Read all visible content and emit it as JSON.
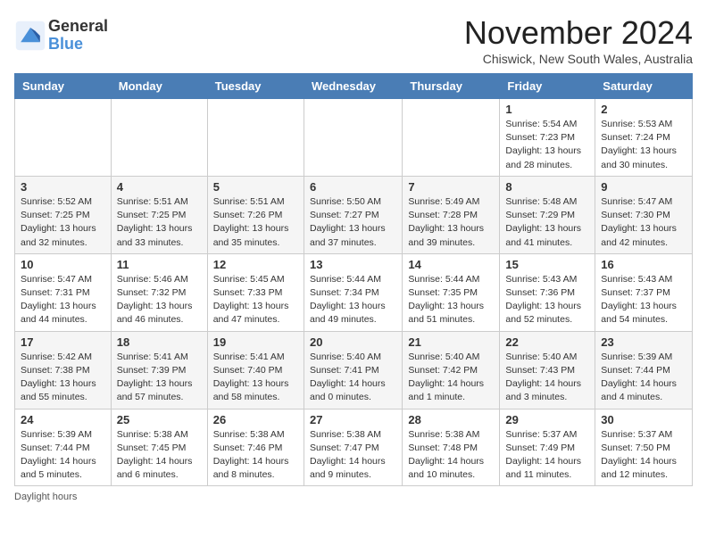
{
  "header": {
    "logo_general": "General",
    "logo_blue": "Blue",
    "month_title": "November 2024",
    "location": "Chiswick, New South Wales, Australia"
  },
  "days_of_week": [
    "Sunday",
    "Monday",
    "Tuesday",
    "Wednesday",
    "Thursday",
    "Friday",
    "Saturday"
  ],
  "footer": {
    "daylight_label": "Daylight hours"
  },
  "weeks": [
    [
      {
        "day": "",
        "info": ""
      },
      {
        "day": "",
        "info": ""
      },
      {
        "day": "",
        "info": ""
      },
      {
        "day": "",
        "info": ""
      },
      {
        "day": "",
        "info": ""
      },
      {
        "day": "1",
        "info": "Sunrise: 5:54 AM\nSunset: 7:23 PM\nDaylight: 13 hours\nand 28 minutes."
      },
      {
        "day": "2",
        "info": "Sunrise: 5:53 AM\nSunset: 7:24 PM\nDaylight: 13 hours\nand 30 minutes."
      }
    ],
    [
      {
        "day": "3",
        "info": "Sunrise: 5:52 AM\nSunset: 7:25 PM\nDaylight: 13 hours\nand 32 minutes."
      },
      {
        "day": "4",
        "info": "Sunrise: 5:51 AM\nSunset: 7:25 PM\nDaylight: 13 hours\nand 33 minutes."
      },
      {
        "day": "5",
        "info": "Sunrise: 5:51 AM\nSunset: 7:26 PM\nDaylight: 13 hours\nand 35 minutes."
      },
      {
        "day": "6",
        "info": "Sunrise: 5:50 AM\nSunset: 7:27 PM\nDaylight: 13 hours\nand 37 minutes."
      },
      {
        "day": "7",
        "info": "Sunrise: 5:49 AM\nSunset: 7:28 PM\nDaylight: 13 hours\nand 39 minutes."
      },
      {
        "day": "8",
        "info": "Sunrise: 5:48 AM\nSunset: 7:29 PM\nDaylight: 13 hours\nand 41 minutes."
      },
      {
        "day": "9",
        "info": "Sunrise: 5:47 AM\nSunset: 7:30 PM\nDaylight: 13 hours\nand 42 minutes."
      }
    ],
    [
      {
        "day": "10",
        "info": "Sunrise: 5:47 AM\nSunset: 7:31 PM\nDaylight: 13 hours\nand 44 minutes."
      },
      {
        "day": "11",
        "info": "Sunrise: 5:46 AM\nSunset: 7:32 PM\nDaylight: 13 hours\nand 46 minutes."
      },
      {
        "day": "12",
        "info": "Sunrise: 5:45 AM\nSunset: 7:33 PM\nDaylight: 13 hours\nand 47 minutes."
      },
      {
        "day": "13",
        "info": "Sunrise: 5:44 AM\nSunset: 7:34 PM\nDaylight: 13 hours\nand 49 minutes."
      },
      {
        "day": "14",
        "info": "Sunrise: 5:44 AM\nSunset: 7:35 PM\nDaylight: 13 hours\nand 51 minutes."
      },
      {
        "day": "15",
        "info": "Sunrise: 5:43 AM\nSunset: 7:36 PM\nDaylight: 13 hours\nand 52 minutes."
      },
      {
        "day": "16",
        "info": "Sunrise: 5:43 AM\nSunset: 7:37 PM\nDaylight: 13 hours\nand 54 minutes."
      }
    ],
    [
      {
        "day": "17",
        "info": "Sunrise: 5:42 AM\nSunset: 7:38 PM\nDaylight: 13 hours\nand 55 minutes."
      },
      {
        "day": "18",
        "info": "Sunrise: 5:41 AM\nSunset: 7:39 PM\nDaylight: 13 hours\nand 57 minutes."
      },
      {
        "day": "19",
        "info": "Sunrise: 5:41 AM\nSunset: 7:40 PM\nDaylight: 13 hours\nand 58 minutes."
      },
      {
        "day": "20",
        "info": "Sunrise: 5:40 AM\nSunset: 7:41 PM\nDaylight: 14 hours\nand 0 minutes."
      },
      {
        "day": "21",
        "info": "Sunrise: 5:40 AM\nSunset: 7:42 PM\nDaylight: 14 hours\nand 1 minute."
      },
      {
        "day": "22",
        "info": "Sunrise: 5:40 AM\nSunset: 7:43 PM\nDaylight: 14 hours\nand 3 minutes."
      },
      {
        "day": "23",
        "info": "Sunrise: 5:39 AM\nSunset: 7:44 PM\nDaylight: 14 hours\nand 4 minutes."
      }
    ],
    [
      {
        "day": "24",
        "info": "Sunrise: 5:39 AM\nSunset: 7:44 PM\nDaylight: 14 hours\nand 5 minutes."
      },
      {
        "day": "25",
        "info": "Sunrise: 5:38 AM\nSunset: 7:45 PM\nDaylight: 14 hours\nand 6 minutes."
      },
      {
        "day": "26",
        "info": "Sunrise: 5:38 AM\nSunset: 7:46 PM\nDaylight: 14 hours\nand 8 minutes."
      },
      {
        "day": "27",
        "info": "Sunrise: 5:38 AM\nSunset: 7:47 PM\nDaylight: 14 hours\nand 9 minutes."
      },
      {
        "day": "28",
        "info": "Sunrise: 5:38 AM\nSunset: 7:48 PM\nDaylight: 14 hours\nand 10 minutes."
      },
      {
        "day": "29",
        "info": "Sunrise: 5:37 AM\nSunset: 7:49 PM\nDaylight: 14 hours\nand 11 minutes."
      },
      {
        "day": "30",
        "info": "Sunrise: 5:37 AM\nSunset: 7:50 PM\nDaylight: 14 hours\nand 12 minutes."
      }
    ]
  ]
}
